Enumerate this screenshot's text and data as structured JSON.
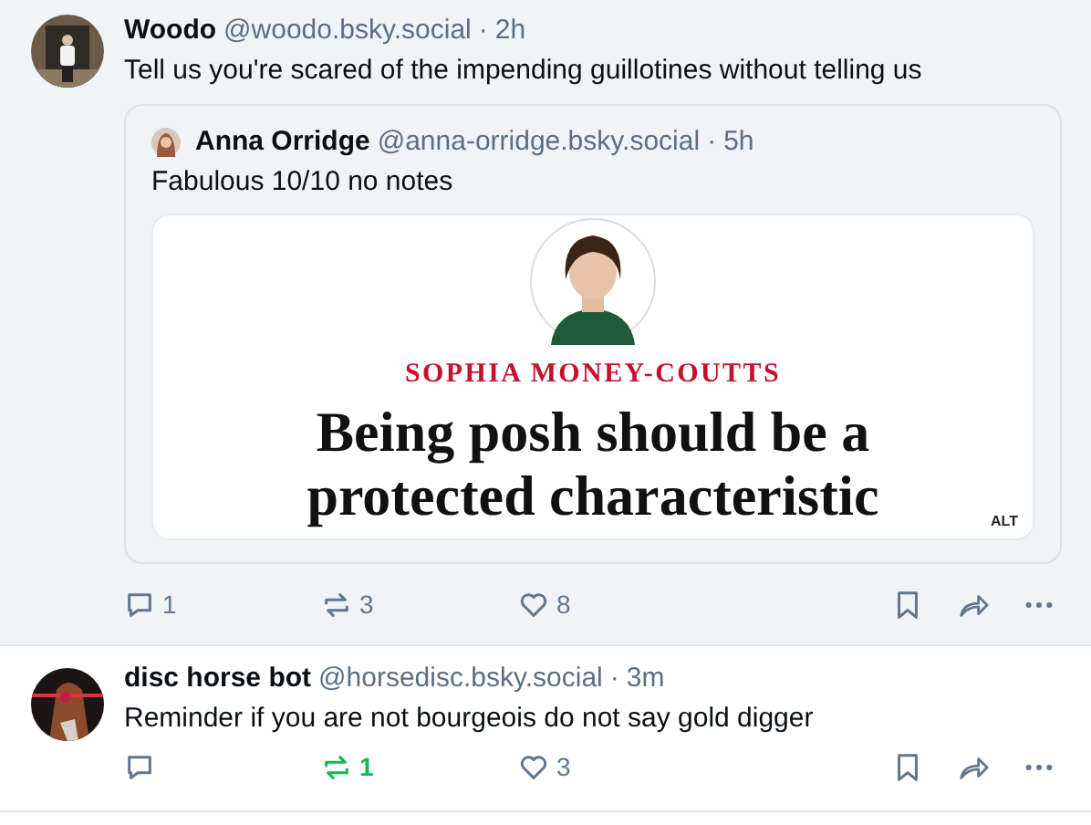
{
  "posts": [
    {
      "selected": true,
      "author": "Woodo",
      "handle": "@woodo.bsky.social",
      "separator": "·",
      "time": "2h",
      "text": "Tell us you're scared of the impending guillotines without telling us",
      "quote": {
        "author": "Anna Orridge",
        "handle": "@anna-orridge.bsky.social",
        "separator": "·",
        "time": "5h",
        "text": "Fabulous 10/10 no notes",
        "image": {
          "byline": "SOPHIA MONEY-COUTTS",
          "headline": "Being posh should be a protected characteristic",
          "badge": "ALT"
        }
      },
      "stats": {
        "replies": "1",
        "reposts": "3",
        "likes": "8",
        "reposted": false,
        "liked": false
      }
    },
    {
      "selected": false,
      "author": "disc horse bot",
      "handle": "@horsedisc.bsky.social",
      "separator": "·",
      "time": "3m",
      "text": "Reminder if you are not bourgeois do not say gold digger",
      "stats": {
        "reposts": "1",
        "likes": "3",
        "reposted": true,
        "liked": false
      }
    }
  ]
}
